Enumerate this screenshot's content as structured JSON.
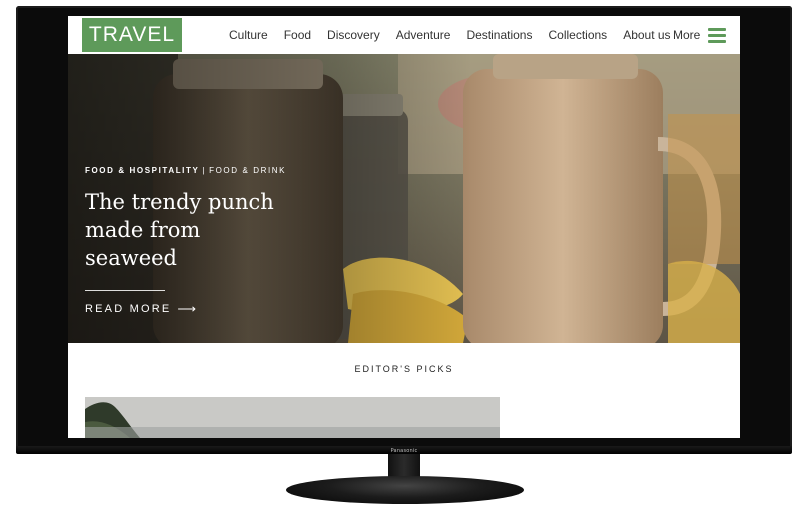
{
  "tv": {
    "brand": "Panasonic"
  },
  "header": {
    "logo": "TRAVEL",
    "nav": [
      "Culture",
      "Food",
      "Discovery",
      "Adventure",
      "Destinations",
      "Collections",
      "About us"
    ],
    "more_label": "More",
    "accent_color": "#5e9a5a"
  },
  "hero": {
    "eyebrow_primary": "FOOD & HOSPITALITY",
    "eyebrow_separator": "|",
    "eyebrow_secondary": "FOOD & DRINK",
    "headline": "The trendy punch made from seaweed",
    "read_more": "READ MORE",
    "read_more_icon": "arrow-right-icon"
  },
  "picks": {
    "title": "EDITOR'S PICKS"
  }
}
